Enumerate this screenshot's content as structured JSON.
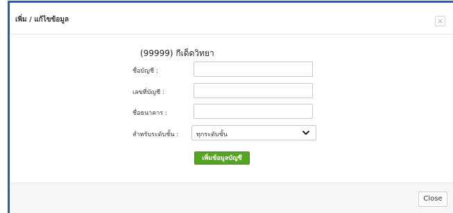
{
  "dialog": {
    "title": "เพิ่ม / แก้ไขข้อมูล",
    "close_x": "×"
  },
  "form": {
    "title": "(99999) กีเด็ดวิทยา",
    "fields": [
      {
        "label": "ชื่อบัญชี :",
        "value": ""
      },
      {
        "label": "เลขที่บัญชี :",
        "value": ""
      },
      {
        "label": "ชื่อธนาคาร :",
        "value": ""
      }
    ],
    "level_label": "สำหรับระดับชั้น :",
    "level_selected": "ทุกระดับชั้น",
    "submit_label": "เพิ่มข้อมูลบัญชี"
  },
  "footer": {
    "close_label": "Close"
  },
  "colors": {
    "accent_border": "#1f5fbf",
    "submit_button": "#56a31f"
  },
  "icons": {
    "close": "close-icon",
    "dropdown": "chevron-down-icon"
  }
}
